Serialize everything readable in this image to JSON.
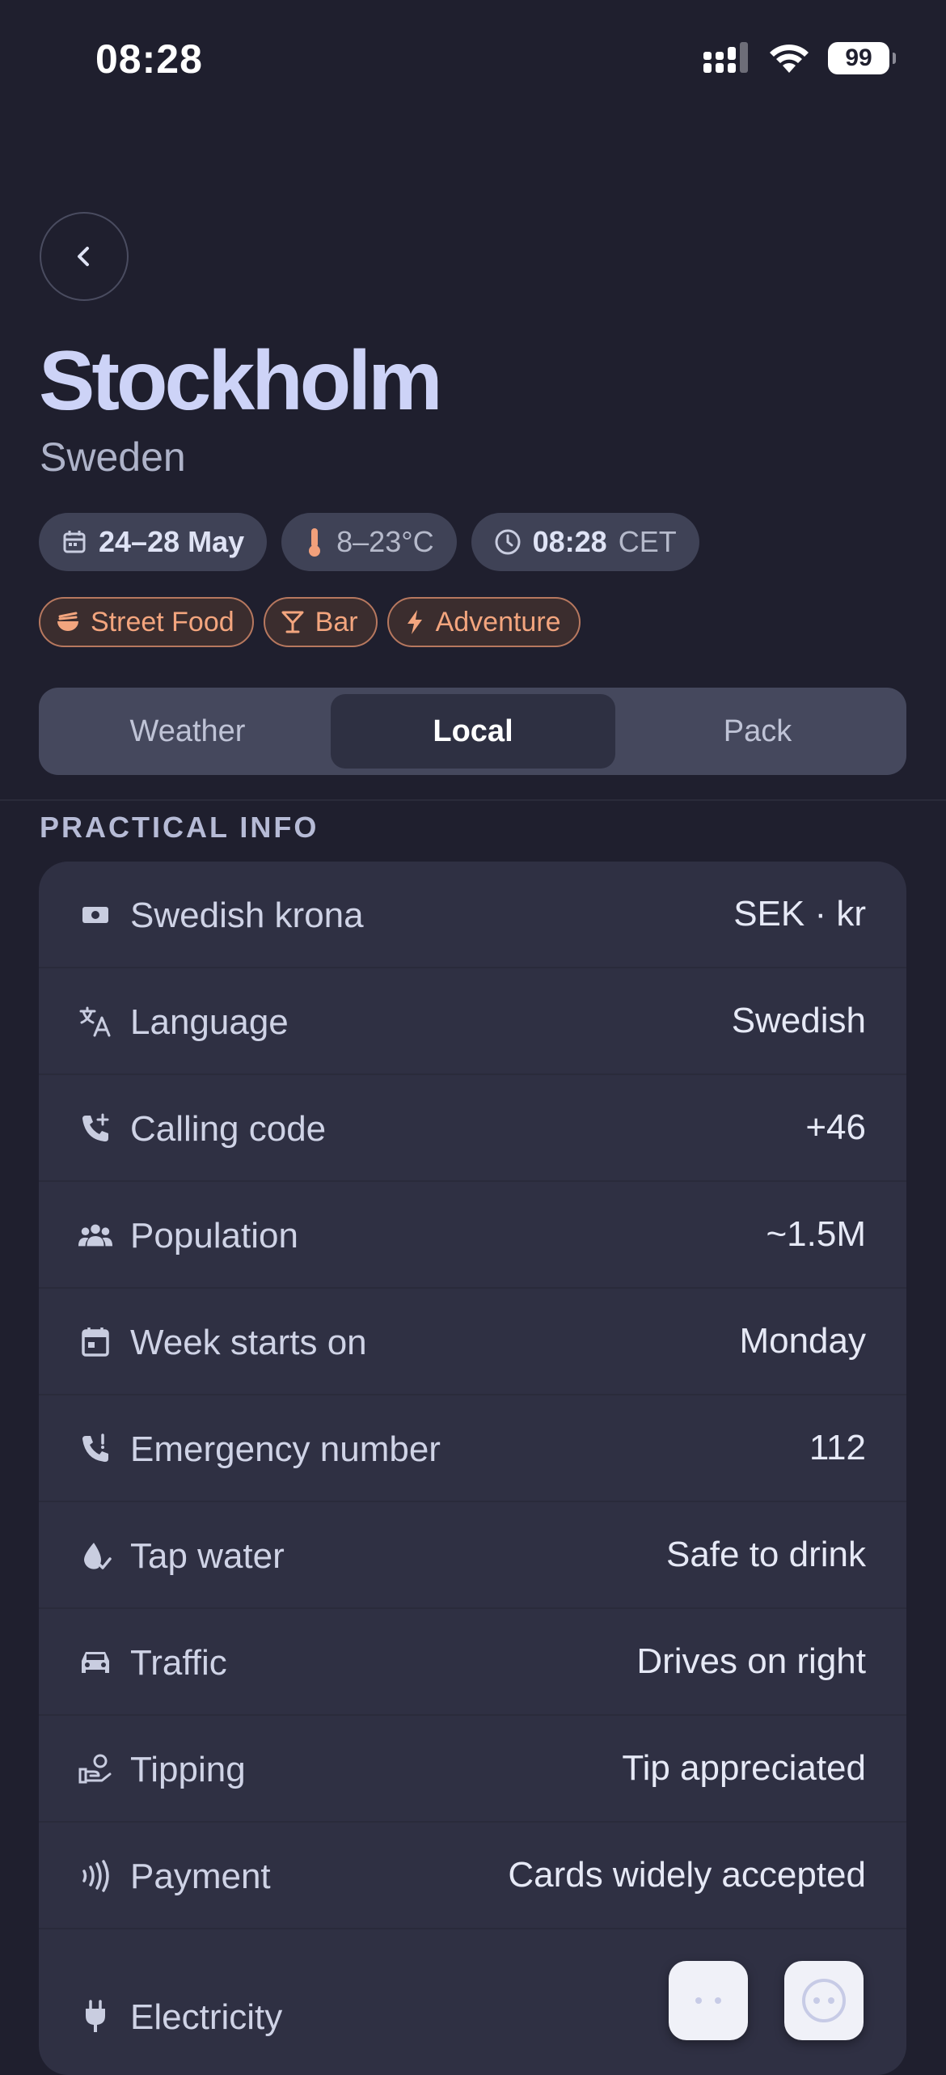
{
  "status_bar": {
    "time": "08:28",
    "battery": "99"
  },
  "header": {
    "title": "Stockholm",
    "subtitle": "Sweden",
    "info_chips": [
      {
        "icon": "calendar-icon",
        "strong": "24–28 May",
        "muted": ""
      },
      {
        "icon": "thermometer-icon",
        "strong": "",
        "muted": "8–23°C"
      },
      {
        "icon": "clock-icon",
        "strong": "08:28",
        "muted": "CET"
      }
    ],
    "tags": [
      {
        "icon": "noodle-bowl-icon",
        "label": "Street Food"
      },
      {
        "icon": "cocktail-icon",
        "label": "Bar"
      },
      {
        "icon": "bolt-icon",
        "label": "Adventure"
      }
    ]
  },
  "tabs": [
    {
      "label": "Weather",
      "active": false
    },
    {
      "label": "Local",
      "active": true
    },
    {
      "label": "Pack",
      "active": false
    }
  ],
  "section": {
    "title": "PRACTICAL INFO"
  },
  "practical_info": [
    {
      "icon": "banknote-icon",
      "label": "Swedish krona",
      "value": "SEK · kr"
    },
    {
      "icon": "translate-icon",
      "label": "Language",
      "value": "Swedish"
    },
    {
      "icon": "phone-plus-icon",
      "label": "Calling code",
      "value": "+46"
    },
    {
      "icon": "people-icon",
      "label": "Population",
      "value": "~1.5M"
    },
    {
      "icon": "calendar-icon",
      "label": "Week starts on",
      "value": "Monday"
    },
    {
      "icon": "phone-alert-icon",
      "label": "Emergency number",
      "value": "112"
    },
    {
      "icon": "water-drop-icon",
      "label": "Tap water",
      "value": "Safe to drink"
    },
    {
      "icon": "car-icon",
      "label": "Traffic",
      "value": "Drives on right"
    },
    {
      "icon": "hand-coin-icon",
      "label": "Tipping",
      "value": "Tip appreciated"
    },
    {
      "icon": "contactless-icon",
      "label": "Payment",
      "value": "Cards widely accepted"
    },
    {
      "icon": "plug-icon",
      "label": "Electricity",
      "value": ""
    }
  ]
}
